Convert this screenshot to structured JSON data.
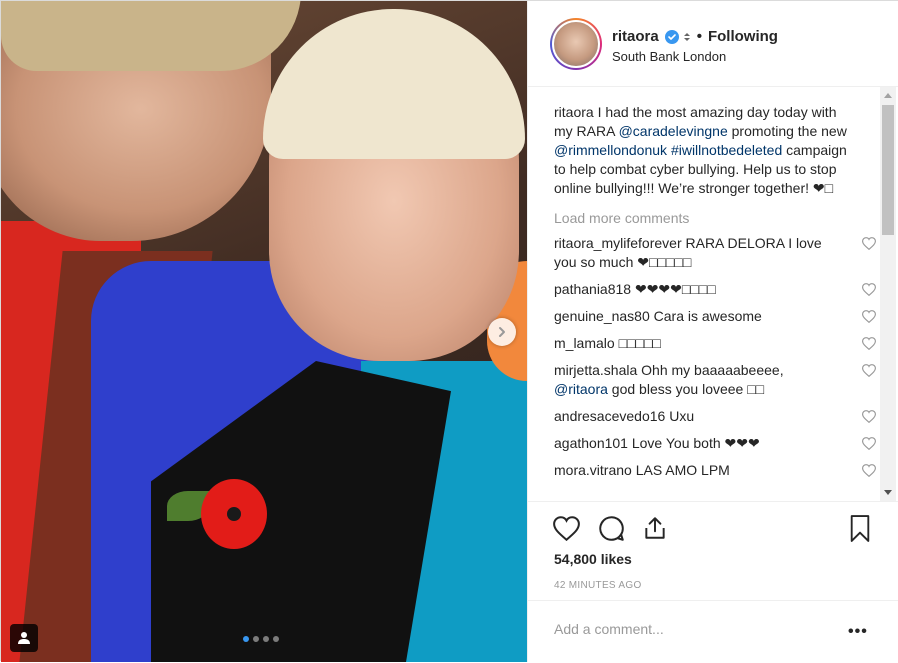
{
  "post": {
    "username": "ritaora",
    "follow_state": "Following",
    "bullet": "•",
    "location": "South Bank London",
    "caption_user": "ritaora",
    "caption_parts": {
      "p1": " I had the most amazing day today with my RARA ",
      "mention1": "@caradelevingne",
      "p2": " promoting the new ",
      "mention2": "@rimmellondonuk",
      "p3": " ",
      "hashtag": "#iwillnotbedeleted",
      "p4": " campaign to help combat cyber bullying. Help us to stop online bullying!!! We’re stronger together! ❤□"
    },
    "load_more_label": "Load more comments",
    "comments": [
      {
        "user": "ritaora_mylifeforever",
        "text": " RARA DELORA I love you so much ❤□□□□□"
      },
      {
        "user": "pathania818",
        "text": " ❤❤❤❤□□□□"
      },
      {
        "user": "genuine_nas80",
        "text": " Cara is awesome"
      },
      {
        "user": "m_lamalo",
        "text": " □□□□□"
      },
      {
        "user": "mirjetta.shala",
        "text": " Ohh my baaaaabeeee, ",
        "mention": "@ritaora",
        "text2": " god bless you loveee □□"
      },
      {
        "user": "andresacevedo16",
        "text": " Uxu"
      },
      {
        "user": "agathon101",
        "text": " Love You both ❤❤❤"
      },
      {
        "user": "mora.vitrano",
        "text": " LAS AMO LPM"
      }
    ],
    "likes": "54,800 likes",
    "timestamp": "42 MINUTES AGO",
    "add_comment_placeholder": "Add a comment...",
    "more_options": "•••"
  },
  "icons": {
    "like": "heart-icon",
    "comment": "comment-icon",
    "share": "share-icon",
    "save": "bookmark-icon",
    "next": "chevron-right-icon",
    "user_tag": "person-icon",
    "verified": "verified-badge-icon"
  },
  "colors": {
    "link": "#003569",
    "verified": "#3897f0",
    "muted": "#999999",
    "carousel_active": "#3897f0"
  },
  "carousel": {
    "count": 4,
    "active_index": 0
  }
}
